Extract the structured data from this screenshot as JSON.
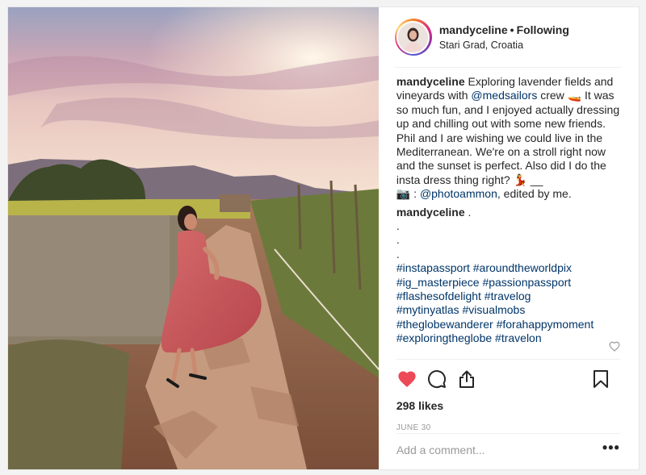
{
  "post": {
    "username": "mandyceline",
    "separator": "•",
    "follow_state": "Following",
    "location": "Stari Grad, Croatia",
    "caption": {
      "username": "mandyceline",
      "text_1": " Exploring lavender fields and vineyards with ",
      "mention_1": "@medsailors",
      "text_2": " crew 🚤  It was so much fun, and I enjoyed actually dressing up and chilling out with some new friends. Phil and I are wishing we could live in the Mediterranean. We're on a stroll right now and the sunset is perfect. Also did I do the insta dress thing right? 💃 __",
      "camera": "📷",
      "text_3": " : ",
      "mention_2": "@photoammon",
      "text_4": ", edited by me."
    },
    "comment": {
      "username": "mandyceline",
      "text": " .",
      "dots": [
        ".",
        ".",
        "."
      ],
      "hashtags": [
        "#instapassport #aroundtheworldpix",
        "#ig_masterpiece #passionpassport",
        "#flashesofdelight #travelog",
        "#mytinyatlas #visualmobs",
        "#theglobewanderer #forahappymoment",
        "#exploringtheglobe #travelon"
      ]
    },
    "likes": "298 likes",
    "date": "JUNE 30",
    "comment_placeholder": "Add a comment...",
    "more_label": "•••",
    "icons": {
      "like": "heart-filled-icon",
      "comment": "comment-bubble-icon",
      "share": "share-icon",
      "save": "bookmark-icon",
      "comment_like": "heart-outline-icon"
    },
    "colors": {
      "liked_heart": "#ed4956",
      "link": "#003569",
      "muted": "#999999"
    }
  }
}
